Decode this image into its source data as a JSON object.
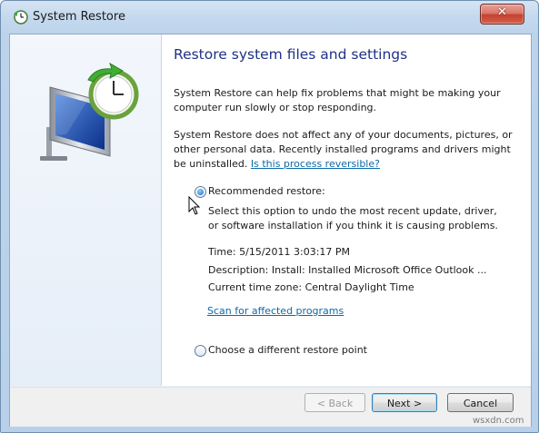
{
  "window": {
    "title": "System Restore"
  },
  "content": {
    "heading": "Restore system files and settings",
    "paragraph1": "System Restore can help fix problems that might be making your computer run slowly or stop responding.",
    "paragraph2": "System Restore does not affect any of your documents, pictures, or other personal data. Recently installed programs and drivers might be uninstalled.",
    "reversible_link": "Is this process reversible?"
  },
  "options": {
    "recommended": {
      "label": "Recommended restore:",
      "selected": true,
      "description": "Select this option to undo the most recent update, driver, or software installation if you think it is causing problems.",
      "time": "Time: 5/15/2011 3:03:17 PM",
      "description_line": "Description: Install: Installed Microsoft Office Outlook ...",
      "timezone": "Current time zone: Central Daylight Time",
      "scan_link": "Scan for affected programs"
    },
    "different": {
      "label": "Choose a different restore point",
      "selected": false
    }
  },
  "buttons": {
    "back": "< Back",
    "next": "Next >",
    "cancel": "Cancel",
    "close_glyph": "✕"
  },
  "watermark": "wsxdn.com",
  "colors": {
    "heading": "#1e3287",
    "link": "#0b6aa8",
    "close": "#c6412f"
  },
  "icons": [
    "system-restore-icon",
    "monitor-clock-icon",
    "close-icon",
    "mouse-cursor-icon"
  ]
}
